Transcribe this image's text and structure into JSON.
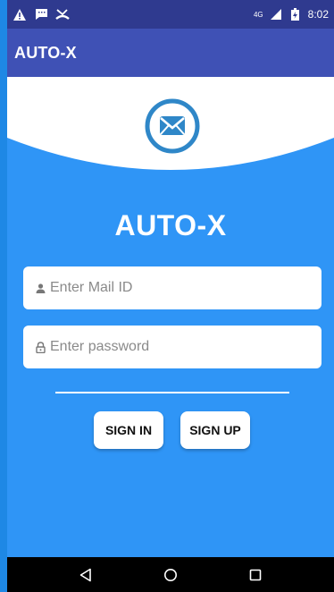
{
  "status_bar": {
    "network": "4G",
    "time": "8:02"
  },
  "app_bar": {
    "title": "AUTO-X"
  },
  "brand": {
    "name": "AUTO-X"
  },
  "form": {
    "mail_placeholder": "Enter Mail ID",
    "mail_value": "",
    "password_placeholder": "Enter password",
    "password_value": ""
  },
  "buttons": {
    "sign_in": "SIGN IN",
    "sign_up": "SIGN UP"
  },
  "icons": {
    "status": [
      "warning-icon",
      "message-icon",
      "missed-call-icon",
      "signal-icon",
      "battery-icon"
    ],
    "logo": "mail-icon",
    "mail_field": "person-icon",
    "password_field": "lock-icon",
    "nav": [
      "back-icon",
      "home-icon",
      "recents-icon"
    ]
  },
  "colors": {
    "status_bar": "#2f3a8f",
    "app_bar": "#3f51b5",
    "background": "#2f95f6",
    "logo_blue": "#2f87c8",
    "nav_bar": "#000000"
  }
}
